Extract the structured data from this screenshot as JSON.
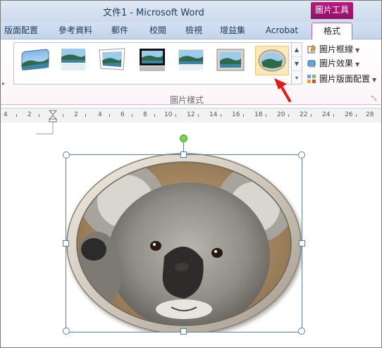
{
  "window": {
    "title_doc": "文件1",
    "title_sep": "-",
    "title_app": "Microsoft Word",
    "context_tools": "圖片工具"
  },
  "tabs": [
    {
      "label": "版面配置",
      "active": false
    },
    {
      "label": "參考資料",
      "active": false
    },
    {
      "label": "郵件",
      "active": false
    },
    {
      "label": "校閱",
      "active": false
    },
    {
      "label": "檢視",
      "active": false
    },
    {
      "label": "增益集",
      "active": false
    },
    {
      "label": "Acrobat",
      "active": false
    },
    {
      "label": "格式",
      "active": true
    }
  ],
  "ribbon": {
    "group_label": "圖片樣式",
    "gallery_styles": [
      {
        "name": "soft-edge-rounded-rectangle",
        "icon": "picture-style-thumbnail"
      },
      {
        "name": "reflected-rectangle",
        "icon": "picture-style-thumbnail"
      },
      {
        "name": "perspective-shadow-white",
        "icon": "picture-style-thumbnail"
      },
      {
        "name": "black-frame-reflection",
        "icon": "picture-style-thumbnail"
      },
      {
        "name": "simple-reflection",
        "icon": "picture-style-thumbnail"
      },
      {
        "name": "metal-frame",
        "icon": "picture-style-thumbnail"
      },
      {
        "name": "metal-oval",
        "icon": "picture-style-thumbnail",
        "selected": true
      }
    ],
    "commands": [
      {
        "label": "圖片框線",
        "icon": "picture-border-icon"
      },
      {
        "label": "圖片效果",
        "icon": "picture-effects-icon"
      },
      {
        "label": "圖片版面配置",
        "icon": "picture-layout-icon"
      }
    ]
  },
  "ruler": {
    "numbers": [
      "4",
      "2",
      "2",
      "4",
      "6",
      "8",
      "10",
      "12",
      "14",
      "16",
      "18",
      "20",
      "22",
      "24",
      "26",
      "28"
    ]
  },
  "colors": {
    "context_accent": "#b0167a",
    "selection": "#5b7fa6",
    "rotation_handle": "#78d64b",
    "arrow": "#e11a1a"
  }
}
